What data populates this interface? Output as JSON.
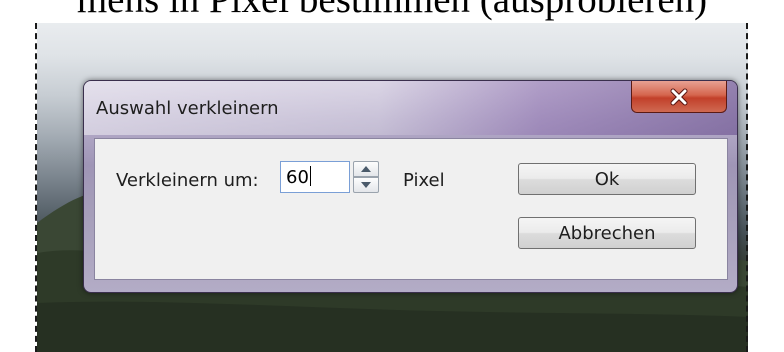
{
  "heading": {
    "text": "mens in Pixel bestimmen (ausprobieren)"
  },
  "dialog": {
    "title": "Auswahl verkleinern",
    "close_icon": "close-icon",
    "shrink_label": "Verkleinern um:",
    "shrink_value": "60",
    "unit_label": "Pixel",
    "ok_label": "Ok",
    "cancel_label": "Abbrechen"
  },
  "colors": {
    "close_button": "#c94a34",
    "dialog_frame": "#a59db9",
    "client_background": "#f0f0f0",
    "input_border": "#7a9fd6"
  }
}
